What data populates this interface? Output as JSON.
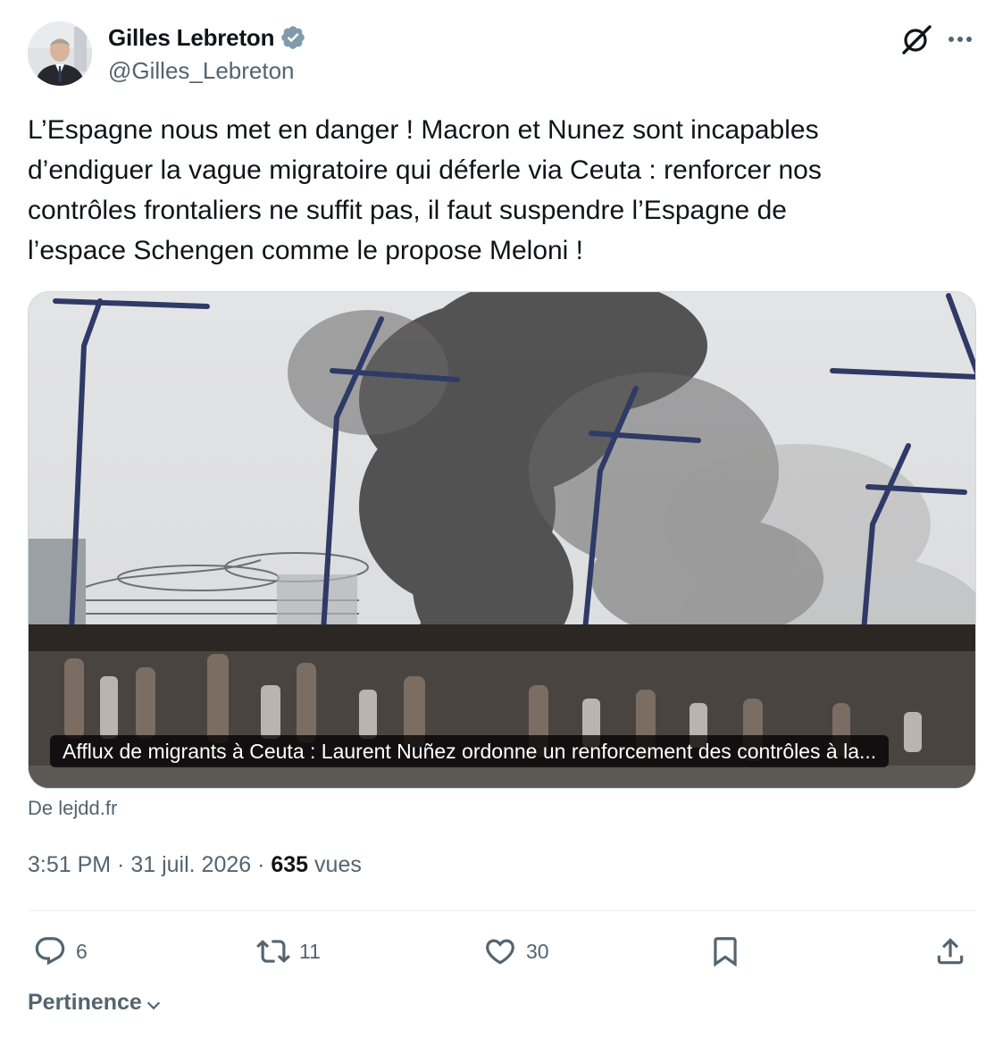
{
  "author": {
    "display_name": "Gilles Lebreton",
    "handle": "@Gilles_Lebreton",
    "verified": true,
    "avatar_icon": "profile-photo"
  },
  "tweet": {
    "text": "L’Espagne nous met en danger ! Macron et Nunez sont incapables\nd’endiguer la vague migratoire qui déferle via Ceuta : renforcer nos\ncontrôles frontaliers ne suffit pas, il faut suspendre l’Espagne de\nl’espace Schengen comme le propose Meloni !"
  },
  "link_card": {
    "caption": "Afflux de migrants à Ceuta : Laurent Nuñez ordonne un renforcement des contrôles à la...",
    "source": "De lejdd.fr"
  },
  "meta": {
    "time": "3:51 PM",
    "separator": " · ",
    "date": "31 juil. 2026",
    "views_count": "635",
    "views_label": " vues"
  },
  "actions": {
    "replies": "6",
    "reposts": "11",
    "likes": "30"
  },
  "sort": {
    "label": "Pertinence"
  },
  "icons": {
    "verified": "verified-badge-icon",
    "grok": "grok-icon",
    "more": "more-icon",
    "reply": "reply-icon",
    "repost": "repost-icon",
    "like": "heart-icon",
    "bookmark": "bookmark-icon",
    "share": "share-icon",
    "chevron": "chevron-down-icon"
  },
  "colors": {
    "text": "#0f1419",
    "secondary": "#536471",
    "verified": "#829aab",
    "border": "#cfd9de"
  }
}
